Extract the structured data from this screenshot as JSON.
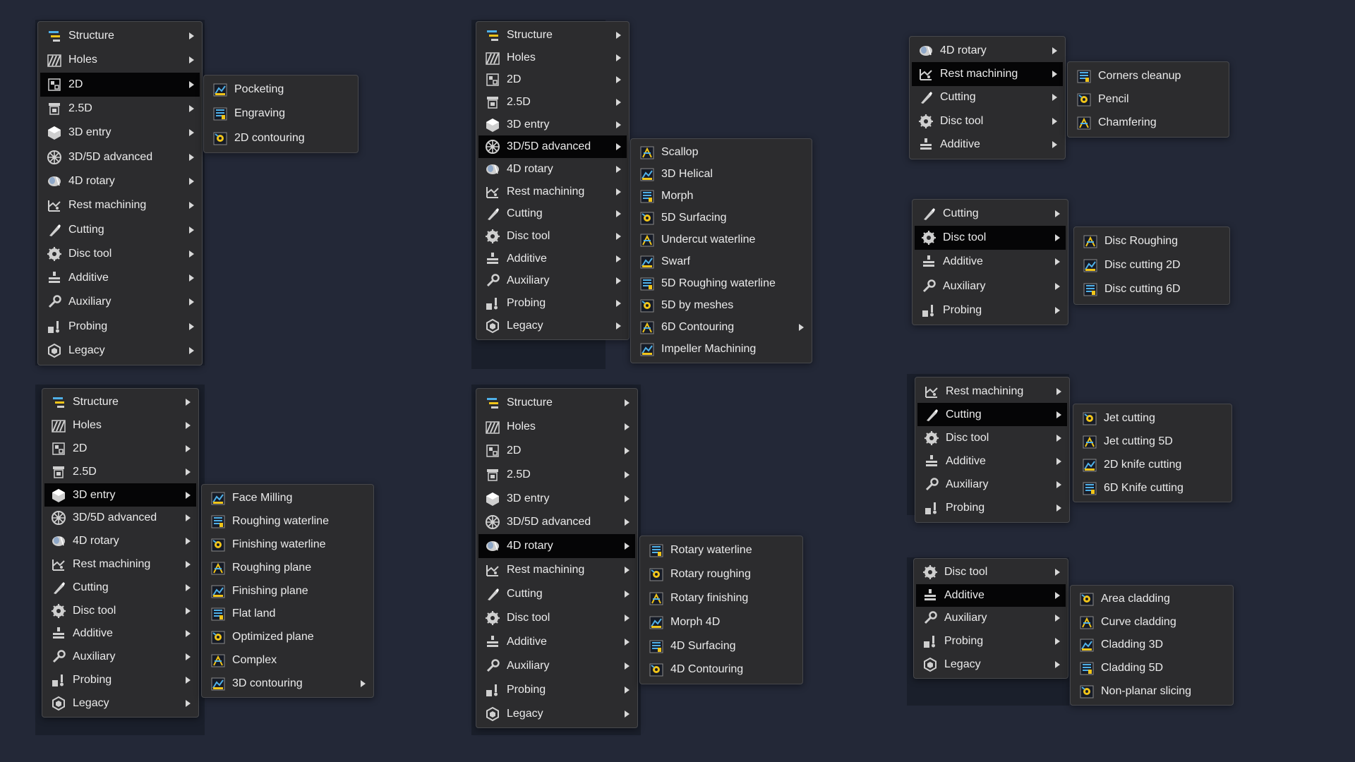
{
  "menus": {
    "m1": [
      "Structure",
      "Holes",
      "2D",
      "2.5D",
      "3D entry",
      "3D/5D advanced",
      "4D rotary",
      "Rest machining",
      "Cutting",
      "Disc tool",
      "Additive",
      "Auxiliary",
      "Probing",
      "Legacy"
    ],
    "s1": [
      "Pocketing",
      "Engraving",
      "2D contouring"
    ],
    "m2": [
      "Structure",
      "Holes",
      "2D",
      "2.5D",
      "3D entry",
      "3D/5D advanced",
      "4D rotary",
      "Rest machining",
      "Cutting",
      "Disc tool",
      "Additive",
      "Auxiliary",
      "Probing",
      "Legacy"
    ],
    "s2": [
      "Scallop",
      "3D Helical",
      "Morph",
      "5D Surfacing",
      "Undercut waterline",
      "Swarf",
      "5D Roughing waterline",
      "5D by meshes",
      "6D Contouring",
      "Impeller Machining"
    ],
    "m3": [
      "4D rotary",
      "Rest machining",
      "Cutting",
      "Disc tool",
      "Additive"
    ],
    "s3": [
      "Corners cleanup",
      "Pencil",
      "Chamfering"
    ],
    "m4": [
      "Structure",
      "Holes",
      "2D",
      "2.5D",
      "3D entry",
      "3D/5D advanced",
      "4D rotary",
      "Rest machining",
      "Cutting",
      "Disc tool",
      "Additive",
      "Auxiliary",
      "Probing",
      "Legacy"
    ],
    "s4": [
      "Face Milling",
      "Roughing waterline",
      "Finishing waterline",
      "Roughing plane",
      "Finishing plane",
      "Flat land",
      "Optimized plane",
      "Complex",
      "3D contouring"
    ],
    "m5": [
      "Structure",
      "Holes",
      "2D",
      "2.5D",
      "3D entry",
      "3D/5D advanced",
      "4D rotary",
      "Rest machining",
      "Cutting",
      "Disc tool",
      "Additive",
      "Auxiliary",
      "Probing",
      "Legacy"
    ],
    "s5": [
      "Rotary waterline",
      "Rotary roughing",
      "Rotary finishing",
      "Morph 4D",
      "4D Surfacing",
      "4D Contouring"
    ],
    "m6": [
      "Cutting",
      "Disc tool",
      "Additive",
      "Auxiliary",
      "Probing"
    ],
    "s6": [
      "Disc Roughing",
      "Disc cutting 2D",
      "Disc cutting 6D"
    ],
    "m7": [
      "Rest machining",
      "Cutting",
      "Disc tool",
      "Additive",
      "Auxiliary",
      "Probing"
    ],
    "s7": [
      "Jet cutting",
      "Jet cutting 5D",
      "2D knife cutting",
      "6D Knife cutting"
    ],
    "m8": [
      "Disc tool",
      "Additive",
      "Auxiliary",
      "Probing",
      "Legacy"
    ],
    "s8": [
      "Area cladding",
      "Curve cladding",
      "Cladding 3D",
      "Cladding 5D",
      "Non-planar slicing"
    ]
  },
  "icons": {
    "Structure": "structure-icon",
    "Holes": "holes-icon",
    "2D": "2d-icon",
    "2.5D": "2-5d-icon",
    "3D entry": "3d-entry-icon",
    "3D/5D advanced": "3d-5d-advanced-icon",
    "4D rotary": "4d-rotary-icon",
    "Rest machining": "rest-machining-icon",
    "Cutting": "cutting-icon",
    "Disc tool": "disc-tool-icon",
    "Additive": "additive-icon",
    "Auxiliary": "auxiliary-icon",
    "Probing": "probing-icon",
    "Legacy": "legacy-icon"
  },
  "colors": {
    "background": "#232837",
    "menu_bg": "#2c2c2e",
    "menu_border": "#47484c",
    "active_row": "#050506",
    "text": "#ebebeb",
    "icon_blue": "#4fb0e8",
    "icon_yellow": "#f0c419",
    "icon_grey": "#cfcfcf"
  }
}
